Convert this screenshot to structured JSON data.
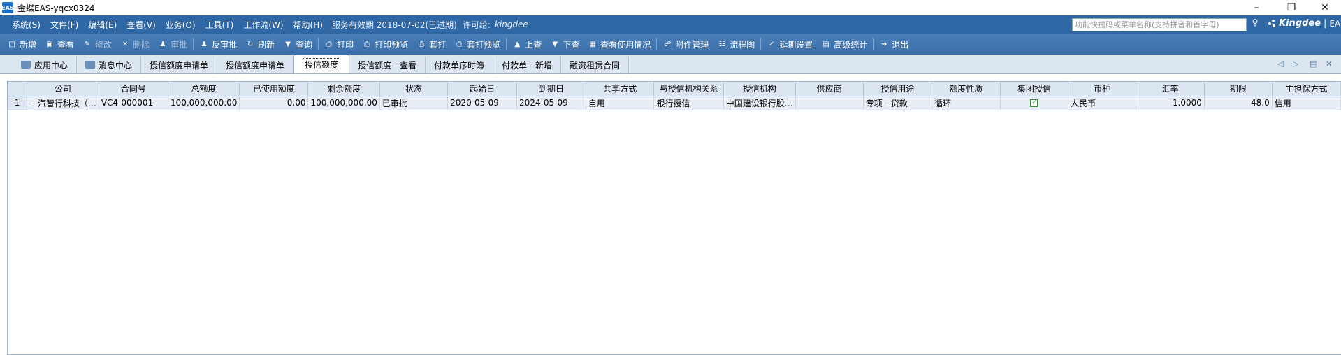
{
  "window": {
    "title": "金蝶EAS-yqcx0324",
    "icon_label": "EAS"
  },
  "menubar": {
    "items": [
      "系统(S)",
      "文件(F)",
      "编辑(E)",
      "查看(V)",
      "业务(O)",
      "工具(T)",
      "工作流(W)",
      "帮助(H)"
    ],
    "service_info": "服务有效期 2018-07-02(已过期)",
    "license_label": "许可给:",
    "license_name": "kingdee",
    "quick_search_placeholder": "功能快捷码或菜单名称(支持拼音和首字母)",
    "brand": "Kingdee",
    "brand_product": "EAS"
  },
  "toolbar": {
    "buttons": [
      {
        "label": "新增",
        "icon": "new-icon",
        "enabled": true
      },
      {
        "label": "查看",
        "icon": "view-icon",
        "enabled": true
      },
      {
        "label": "修改",
        "icon": "edit-icon",
        "enabled": false
      },
      {
        "label": "删除",
        "icon": "delete-icon",
        "enabled": false
      },
      {
        "label": "审批",
        "icon": "approve-icon",
        "enabled": false
      },
      {
        "label": "反审批",
        "icon": "unapprove-icon",
        "enabled": true
      },
      {
        "label": "刷新",
        "icon": "refresh-icon",
        "enabled": true
      },
      {
        "label": "查询",
        "icon": "query-icon",
        "enabled": true
      },
      {
        "label": "打印",
        "icon": "print-icon",
        "enabled": true
      },
      {
        "label": "打印预览",
        "icon": "print-preview-icon",
        "enabled": true
      },
      {
        "label": "套打",
        "icon": "template-print-icon",
        "enabled": true
      },
      {
        "label": "套打预览",
        "icon": "template-preview-icon",
        "enabled": true
      },
      {
        "label": "上查",
        "icon": "trace-up-icon",
        "enabled": true
      },
      {
        "label": "下查",
        "icon": "trace-down-icon",
        "enabled": true
      },
      {
        "label": "查看使用情况",
        "icon": "usage-icon",
        "enabled": true
      },
      {
        "label": "附件管理",
        "icon": "attachment-icon",
        "enabled": true
      },
      {
        "label": "流程图",
        "icon": "flowchart-icon",
        "enabled": true
      },
      {
        "label": "延期设置",
        "icon": "extend-icon",
        "enabled": true
      },
      {
        "label": "高级统计",
        "icon": "stats-icon",
        "enabled": true
      },
      {
        "label": "退出",
        "icon": "exit-icon",
        "enabled": true
      }
    ]
  },
  "tabs": [
    {
      "label": "应用中心",
      "active": false
    },
    {
      "label": "消息中心",
      "active": false
    },
    {
      "label": "授信额度申请单",
      "active": false
    },
    {
      "label": "授信额度申请单",
      "active": false
    },
    {
      "label": "授信额度",
      "active": true
    },
    {
      "label": "授信额度 - 查看",
      "active": false
    },
    {
      "label": "付款单序时簿",
      "active": false
    },
    {
      "label": "付款单 - 新增",
      "active": false
    },
    {
      "label": "融资租赁合同",
      "active": false
    }
  ],
  "grid": {
    "columns": [
      "",
      "公司",
      "合同号",
      "总额度",
      "已使用额度",
      "剩余额度",
      "状态",
      "起始日",
      "到期日",
      "共享方式",
      "与授信机构关系",
      "授信机构",
      "供应商",
      "授信用途",
      "额度性质",
      "集团授信",
      "币种",
      "汇率",
      "期限",
      "主担保方式"
    ],
    "rows": [
      {
        "index": "1",
        "company": "一汽智行科技（…",
        "contract_no": "VC4-000001",
        "total": "100,000,000.00",
        "used": "0.00",
        "remaining": "100,000,000.00",
        "status": "已审批",
        "start_date": "2020-05-09",
        "end_date": "2024-05-09",
        "share_mode": "自用",
        "relation": "银行授信",
        "institution": "中国建设银行股…",
        "supplier": "",
        "purpose": "专项－贷款",
        "nature": "循环",
        "group_credit": true,
        "currency": "人民币",
        "rate": "1.0000",
        "term": "48.0",
        "guarantee": "信用"
      }
    ]
  }
}
